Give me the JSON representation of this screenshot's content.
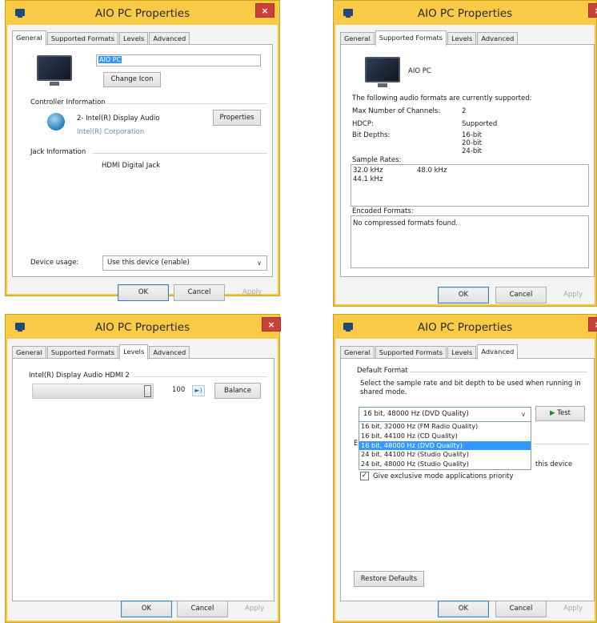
{
  "window_title": "AIO PC Properties",
  "close_glyph": "×",
  "tabs": {
    "general": "General",
    "supported_formats": "Supported Formats",
    "levels": "Levels",
    "advanced": "Advanced"
  },
  "footer": {
    "ok": "OK",
    "cancel": "Cancel",
    "apply": "Apply"
  },
  "general": {
    "device_name_value": "AIO PC",
    "change_icon_button": "Change Icon",
    "controller_section": "Controller Information",
    "controller_name": "2- Intel(R) Display Audio",
    "controller_vendor": "Intel(R) Corporation",
    "properties_button": "Properties",
    "jack_section": "Jack Information",
    "jack_value": "HDMI Digital Jack",
    "device_usage_label": "Device usage:",
    "device_usage_value": "Use this device (enable)"
  },
  "formats": {
    "device_name": "AIO PC",
    "intro": "The following audio formats are currently supported:",
    "max_channels_label": "Max Number of Channels:",
    "max_channels_value": "2",
    "hdcp_label": "HDCP:",
    "hdcp_value": "Supported",
    "bit_depths_label": "Bit Depths:",
    "bit_depths": [
      "16-bit",
      "20-bit",
      "24-bit"
    ],
    "sample_rates_label": "Sample Rates:",
    "sample_rates": [
      "32.0 kHz",
      "44.1 kHz",
      "48.0 kHz"
    ],
    "encoded_label": "Encoded Formats:",
    "encoded_value": "No compressed formats found."
  },
  "levels": {
    "device_label": "Intel(R) Display Audio HDMI 2",
    "volume_value": "100",
    "volume_level_percent": 100,
    "balance_button": "Balance"
  },
  "advanced": {
    "default_format_section": "Default Format",
    "description": "Select the sample rate and bit depth to be used when running in shared mode.",
    "selected_format": "16 bit, 48000 Hz (DVD Quality)",
    "test_button": "Test",
    "format_options": [
      "16 bit, 32000 Hz (FM Radio Quality)",
      "16 bit, 44100 Hz (CD Quality)",
      "16 bit, 48000 Hz (DVD Quality)",
      "24 bit, 44100 Hz (Studio Quality)",
      "24 bit, 48000 Hz (Studio Quality)"
    ],
    "exclusive_partial_letter": "E",
    "exclusive_allow_tail": "this device",
    "exclusive_priority": "Give exclusive mode applications priority",
    "restore_defaults_button": "Restore Defaults"
  },
  "icons": {
    "window_icon": "monitor-icon",
    "speaker": "speaker-icon",
    "test_play": "play-icon",
    "dropdown": "chevron-down-icon"
  },
  "colors": {
    "titlebar": "#f9ca45",
    "close": "#c9413a",
    "selection": "#3399ff"
  }
}
